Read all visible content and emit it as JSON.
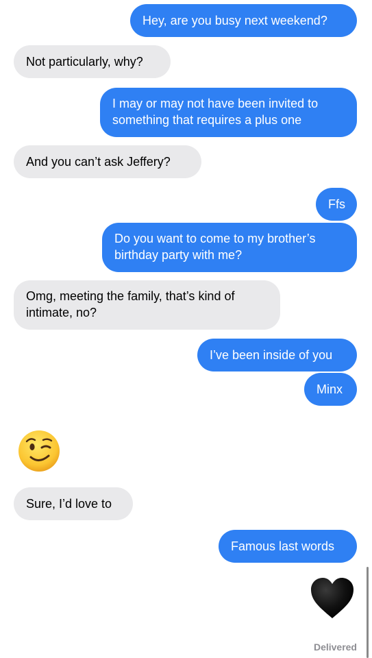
{
  "messages": [
    {
      "side": "out",
      "lines": [
        "Hey, are you busy next weekend?"
      ]
    },
    {
      "side": "in",
      "lines": [
        "Not particularly, why?"
      ]
    },
    {
      "side": "out",
      "lines": [
        "I may or may not have been invited to",
        "something that requires a plus one"
      ]
    },
    {
      "side": "in",
      "lines": [
        "And you can’t ask Jeffery?"
      ]
    },
    {
      "side": "out",
      "lines": [
        "Ffs"
      ]
    },
    {
      "side": "out",
      "lines": [
        "Do you want to come to my brother’s",
        "birthday party with me?"
      ]
    },
    {
      "side": "in",
      "lines": [
        "Omg, meeting the family, that’s kind of",
        "intimate, no?"
      ]
    },
    {
      "side": "out",
      "lines": [
        "I’ve been inside of you"
      ]
    },
    {
      "side": "out",
      "lines": [
        "Minx"
      ]
    },
    {
      "side": "in",
      "emoji": "winking-face-emoji"
    },
    {
      "side": "in",
      "lines": [
        "Sure, I’d love to"
      ]
    },
    {
      "side": "out",
      "lines": [
        "Famous last words"
      ]
    },
    {
      "side": "out",
      "emoji": "black-heart-emoji"
    }
  ],
  "status": "Delivered",
  "colors": {
    "outgoing_bubble": "#2f80f3",
    "incoming_bubble": "#e9e9eb",
    "status_text": "#8e8e93"
  }
}
